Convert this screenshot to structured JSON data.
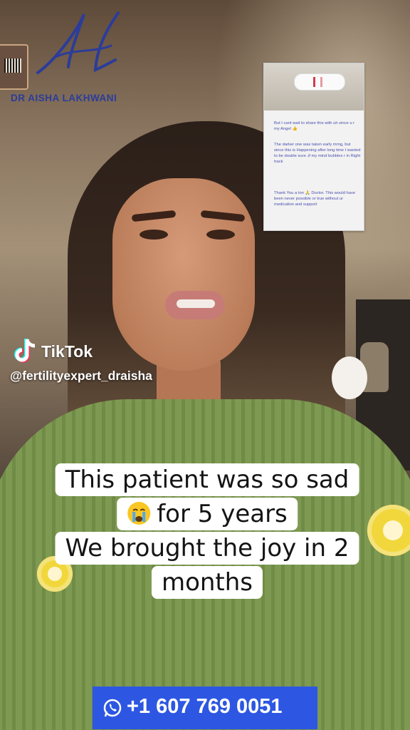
{
  "brand": {
    "name": "DR AISHA LAKHWANI",
    "color": "#2c3c9a"
  },
  "overlay_card": {
    "messages": [
      "But I cant wait to share this with uh since u r my Angel 👍",
      "The darker one was taken early mrng, but since this is Happening after long time I wanted to be double sure ,if my mind bubbles r in Right track",
      "Thank You a ton 🙏 Doctor. This would have been never possible or true without ur medication and support"
    ]
  },
  "watermark": {
    "app": "TikTok",
    "handle": "@fertilityexpert_draisha"
  },
  "caption": {
    "lines": [
      "This patient was so sad",
      "for 5 years",
      "We brought the joy in 2",
      "months"
    ],
    "emoji": "crying-face-icon"
  },
  "contact": {
    "phone": "+1 607 769 0051",
    "icon": "whatsapp-icon",
    "bar_color": "#2d57e2"
  }
}
